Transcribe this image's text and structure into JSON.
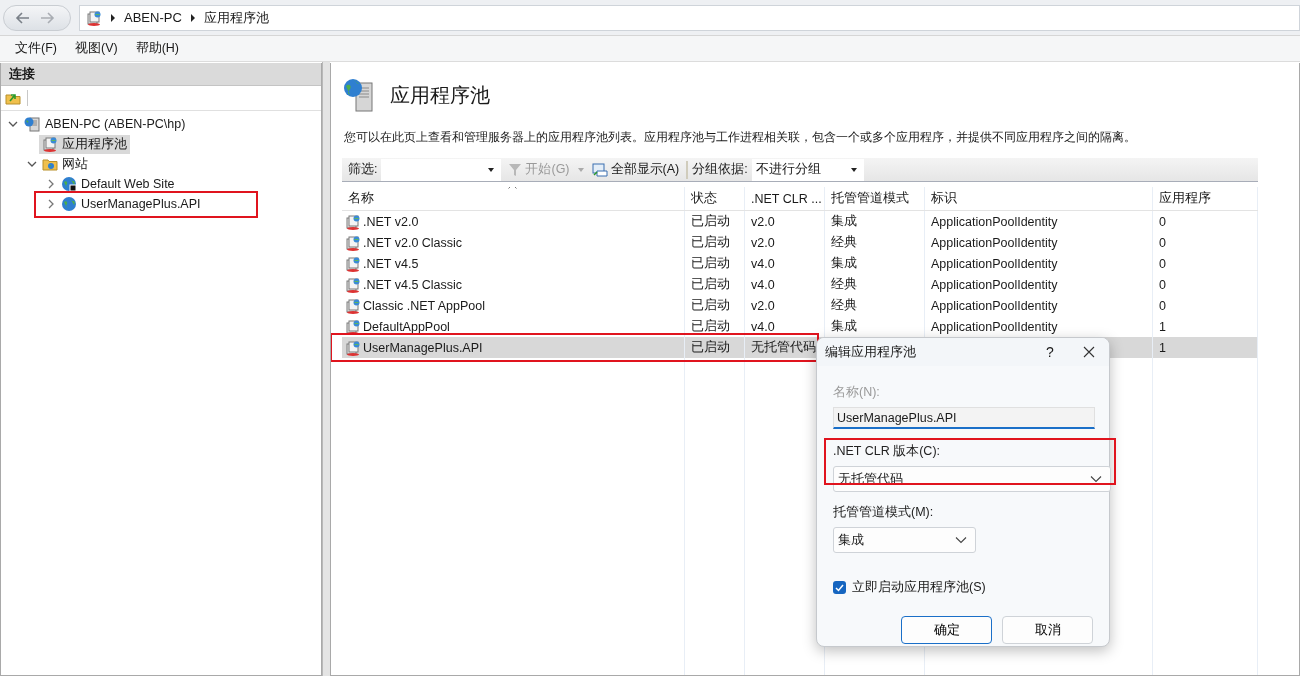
{
  "address_bar": {
    "crumbs": [
      "ABEN-PC",
      "应用程序池"
    ]
  },
  "menu": [
    "文件(F)",
    "视图(V)",
    "帮助(H)"
  ],
  "connections": {
    "title": "连接",
    "tree": [
      {
        "label": "ABEN-PC (ABEN-PC\\hp)",
        "kind": "server",
        "expanded": true,
        "selected": false,
        "highlighted": false,
        "children": [
          {
            "label": "应用程序池",
            "kind": "pools",
            "selected": true,
            "highlighted": false
          },
          {
            "label": "网站",
            "kind": "sites",
            "expanded": true,
            "selected": false,
            "highlighted": false,
            "children": [
              {
                "label": "Default Web Site",
                "kind": "site",
                "expanded": false,
                "stopped": true,
                "selected": false,
                "highlighted": false
              },
              {
                "label": "UserManagePlus.API",
                "kind": "site",
                "expanded": false,
                "stopped": false,
                "selected": false,
                "highlighted": true
              }
            ]
          }
        ]
      }
    ]
  },
  "page": {
    "title": "应用程序池",
    "description": "您可以在此页上查看和管理服务器上的应用程序池列表。应用程序池与工作进程相关联，包含一个或多个应用程序，并提供不同应用程序之间的隔离。",
    "toolbar": {
      "filter_label": "筛选:",
      "start": {
        "label": "开始(G)",
        "disabled": true
      },
      "show_all": "全部显示(A)",
      "group_label": "分组依据:",
      "group_value": "不进行分组"
    },
    "table": {
      "columns": [
        "名称",
        "状态",
        ".NET CLR ...",
        "托管管道模式",
        "标识",
        "应用程序"
      ],
      "rows": [
        {
          "cells": [
            ".NET v2.0",
            "已启动",
            "v2.0",
            "集成",
            "ApplicationPoolIdentity",
            "0"
          ],
          "selected": false,
          "highlighted": false
        },
        {
          "cells": [
            ".NET v2.0 Classic",
            "已启动",
            "v2.0",
            "经典",
            "ApplicationPoolIdentity",
            "0"
          ],
          "selected": false,
          "highlighted": false
        },
        {
          "cells": [
            ".NET v4.5",
            "已启动",
            "v4.0",
            "集成",
            "ApplicationPoolIdentity",
            "0"
          ],
          "selected": false,
          "highlighted": false
        },
        {
          "cells": [
            ".NET v4.5 Classic",
            "已启动",
            "v4.0",
            "经典",
            "ApplicationPoolIdentity",
            "0"
          ],
          "selected": false,
          "highlighted": false
        },
        {
          "cells": [
            "Classic .NET AppPool",
            "已启动",
            "v2.0",
            "经典",
            "ApplicationPoolIdentity",
            "0"
          ],
          "selected": false,
          "highlighted": false
        },
        {
          "cells": [
            "DefaultAppPool",
            "已启动",
            "v4.0",
            "集成",
            "ApplicationPoolIdentity",
            "1"
          ],
          "selected": false,
          "highlighted": false
        },
        {
          "cells": [
            "UserManagePlus.API",
            "已启动",
            "无托管代码",
            null,
            null,
            "1"
          ],
          "selected": true,
          "highlighted": true
        }
      ]
    }
  },
  "dialog": {
    "title": "编辑应用程序池",
    "help": "?",
    "name_label": {
      "text": "名称(N):",
      "disabled": true
    },
    "name_value": "UserManagePlus.API",
    "clr_label": ".NET CLR 版本(C):",
    "clr_value": "无托管代码",
    "clr_highlighted": true,
    "pipeline_label": "托管管道模式(M):",
    "pipeline_value": "集成",
    "start_now": {
      "label": "立即启动应用程序池(S)",
      "checked": true
    },
    "buttons": [
      {
        "label": "确定",
        "default": true
      },
      {
        "label": "取消",
        "default": false
      }
    ]
  }
}
